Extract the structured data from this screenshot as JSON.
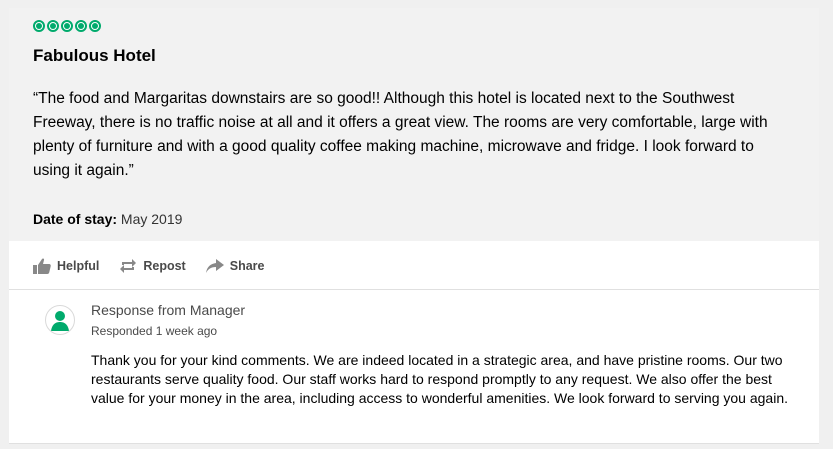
{
  "review": {
    "rating": 5,
    "title": "Fabulous Hotel",
    "body": "“The food and Margaritas downstairs are so good!! Although this hotel is located next to the Southwest Freeway, there is no traffic noise at all and it offers a great view. The rooms are very comfortable, large with plenty of furniture and with a good quality coffee making machine, microwave and fridge. I look forward to using it again.”",
    "stay_label": "Date of stay:",
    "stay_value": "May 2019"
  },
  "actions": {
    "helpful": "Helpful",
    "repost": "Repost",
    "share": "Share"
  },
  "response": {
    "title": "Response from Manager",
    "date": "Responded 1 week ago",
    "body": "Thank you for your kind comments. We are indeed located in a strategic area, and have pristine rooms. Our two restaurants serve quality food. Our staff works hard to respond promptly to any request. We also offer the best value for your money in the area, including access to wonderful amenities. We look forward to serving you again."
  },
  "colors": {
    "rating_green": "#00aa6c",
    "review_background": "#f2f2f2",
    "action_text": "#4a4a4a"
  },
  "icons": {
    "helpful": "thumbs-up-icon",
    "repost": "repost-icon",
    "share": "share-arrow-icon",
    "avatar": "user-avatar-icon"
  }
}
